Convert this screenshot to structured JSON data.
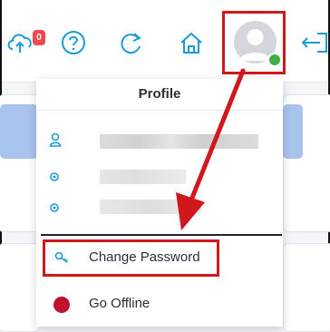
{
  "toolbar": {
    "notification_count": "0",
    "icons": [
      "cloud-upload-icon",
      "help-icon",
      "refresh-icon",
      "home-icon",
      "avatar",
      "logout-icon"
    ]
  },
  "profile_menu": {
    "title": "Profile",
    "items": [
      {
        "label": "Change Password",
        "icon": "key-icon"
      },
      {
        "label": "Go Offline",
        "icon": "status-dot-icon"
      }
    ]
  },
  "colors": {
    "accent": "#1e9ad6",
    "highlight_box": "#d0181c",
    "online_status": "#3fae48",
    "offline_status": "#c1112e",
    "notification_badge": "#f3484e"
  }
}
